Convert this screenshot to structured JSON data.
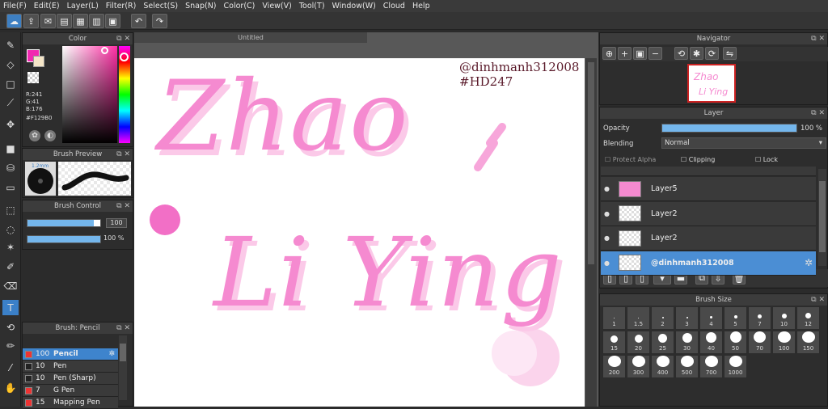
{
  "menu": [
    "File(F)",
    "Edit(E)",
    "Layer(L)",
    "Filter(R)",
    "Select(S)",
    "Snap(N)",
    "Color(C)",
    "View(V)",
    "Tool(T)",
    "Window(W)",
    "Cloud",
    "Help"
  ],
  "color_panel": {
    "title": "Color",
    "r": "R:241",
    "g": "G:41",
    "b": "B:176",
    "hex": "#F129B0",
    "fg": "#F129B0"
  },
  "brush_preview": {
    "title": "Brush Preview",
    "size_label": "1.2mm"
  },
  "brush_control": {
    "title": "Brush Control",
    "size": "100",
    "opacity": "100 %"
  },
  "brush_list": {
    "title": "Brush: Pencil",
    "items": [
      {
        "size": "100",
        "name": "Pencil",
        "color": "#e33"
      },
      {
        "size": "10",
        "name": "Pen",
        "color": "#222"
      },
      {
        "size": "10",
        "name": "Pen (Sharp)",
        "color": "#222"
      },
      {
        "size": "7",
        "name": "G Pen",
        "color": "#e33"
      },
      {
        "size": "15",
        "name": "Mapping Pen",
        "color": "#e33"
      }
    ]
  },
  "canvas": {
    "tab": "Untitled",
    "watermark_line1": "@dinhmanh312008",
    "watermark_line2": "#HD247",
    "text_line1": "Zhao",
    "text_line2": "Li Ying",
    "accent": "#F58AD0"
  },
  "navigator": {
    "title": "Navigator"
  },
  "layer_panel": {
    "title": "Layer",
    "opacity_label": "Opacity",
    "opacity_value": "100 %",
    "opacity_fraction": 1.0,
    "blending_label": "Blending",
    "blending_value": "Normal",
    "protect_alpha": "Protect Alpha",
    "clipping": "Clipping",
    "lock": "Lock",
    "layers": [
      {
        "name": "Layer5",
        "selected": false
      },
      {
        "name": "Layer2",
        "selected": false
      },
      {
        "name": "Layer2",
        "selected": false
      },
      {
        "name": "@dinhmanh312008",
        "selected": true
      }
    ]
  },
  "brush_size": {
    "title": "Brush Size",
    "sizes": [
      "1",
      "1.5",
      "2",
      "3",
      "4",
      "5",
      "7",
      "10",
      "12",
      "15",
      "20",
      "25",
      "30",
      "40",
      "50",
      "70",
      "100",
      "150",
      "200",
      "300",
      "400",
      "500",
      "700",
      "1000"
    ]
  }
}
